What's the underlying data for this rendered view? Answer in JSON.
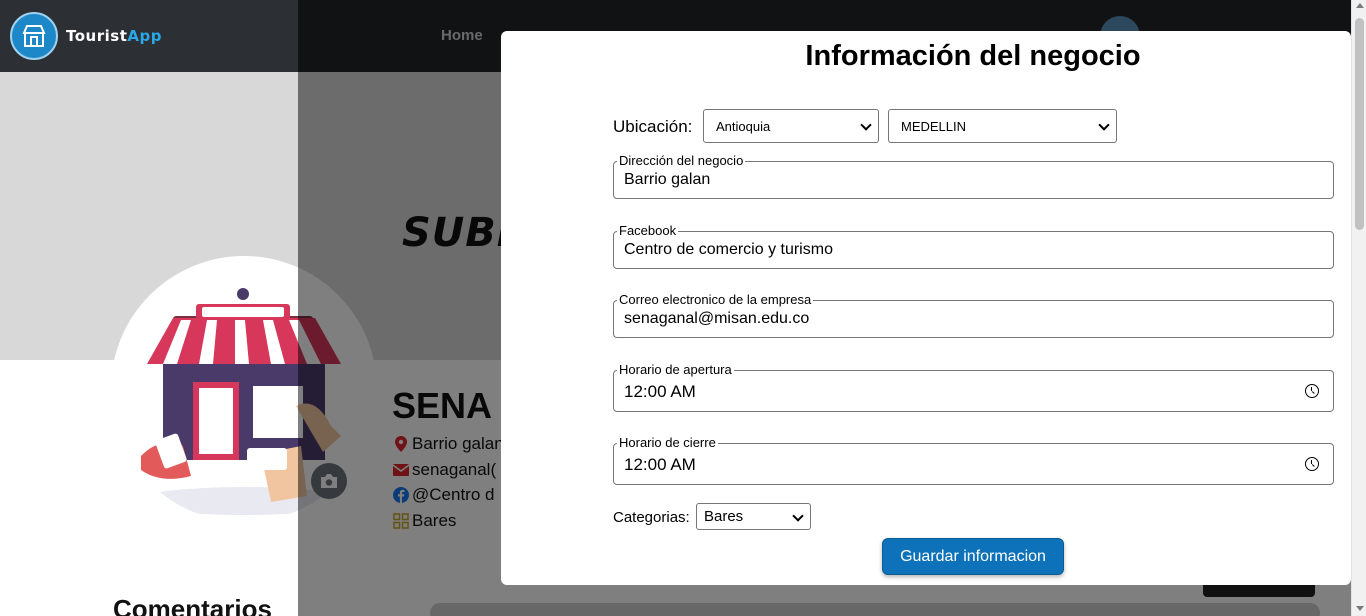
{
  "navbar": {
    "brand_prefix": "Tourist",
    "brand_suffix": "App",
    "home_label": "Home"
  },
  "cover": {
    "text": "SUBE"
  },
  "profile": {
    "name": "SENA",
    "address": "Barrio galan",
    "email": "senaganal(",
    "facebook": "@Centro d",
    "category": "Bares",
    "comments_title": "Comentarios"
  },
  "modal": {
    "title": "Información del negocio",
    "location_label": "Ubicación:",
    "department": "Antioquia",
    "city": "MEDELLIN",
    "fields": [
      {
        "legend": "Dirección del negocio",
        "value": "Barrio galan"
      },
      {
        "legend": "Facebook",
        "value": "Centro de comercio y turismo"
      },
      {
        "legend": "Correo electronico de la empresa",
        "value": "senaganal@misan.edu.co"
      }
    ],
    "opening": {
      "legend": "Horario de apertura",
      "value": "12:00  AM"
    },
    "closing": {
      "legend": "Horario de cierre",
      "value": "12:00  AM"
    },
    "categories_label": "Categorias:",
    "category": "Bares",
    "save_label": "Guardar informacion"
  },
  "colors": {
    "accent": "#0d72b9",
    "brand_accent": "#2aa7e6",
    "navbar": "#212529"
  }
}
